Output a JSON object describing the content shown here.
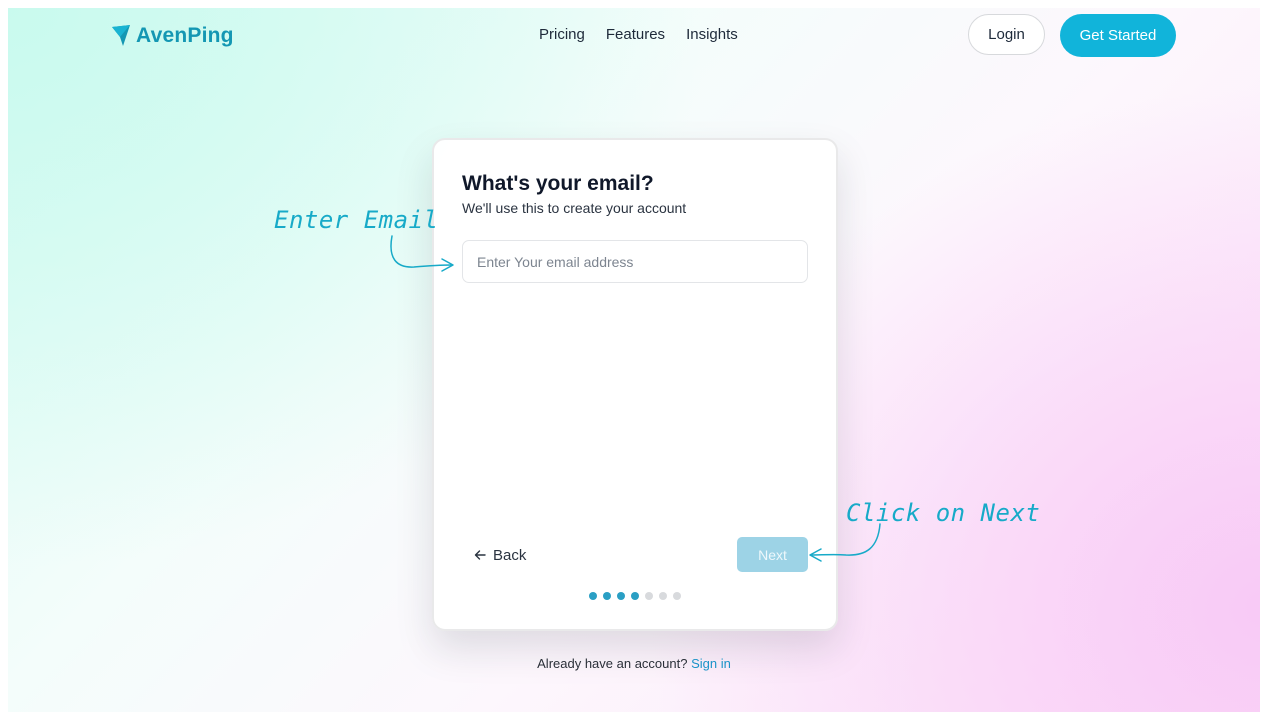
{
  "brand": {
    "name": "AvenPing",
    "color": "#1497b3"
  },
  "nav": {
    "items": [
      "Pricing",
      "Features",
      "Insights"
    ]
  },
  "header": {
    "login_label": "Login",
    "get_started_label": "Get Started",
    "accent": "#11b4da"
  },
  "card": {
    "title": "What's your email?",
    "subtitle": "We'll use this to create your account",
    "email_placeholder": "Enter Your email address",
    "email_value": "",
    "back_label": "Back",
    "next_label": "Next",
    "steps_total": 7,
    "steps_completed": 4
  },
  "footer": {
    "prompt": "Already have an account?",
    "signin_label": "Sign in"
  },
  "annotations": {
    "email": "Enter Email",
    "next": "Click on Next"
  }
}
